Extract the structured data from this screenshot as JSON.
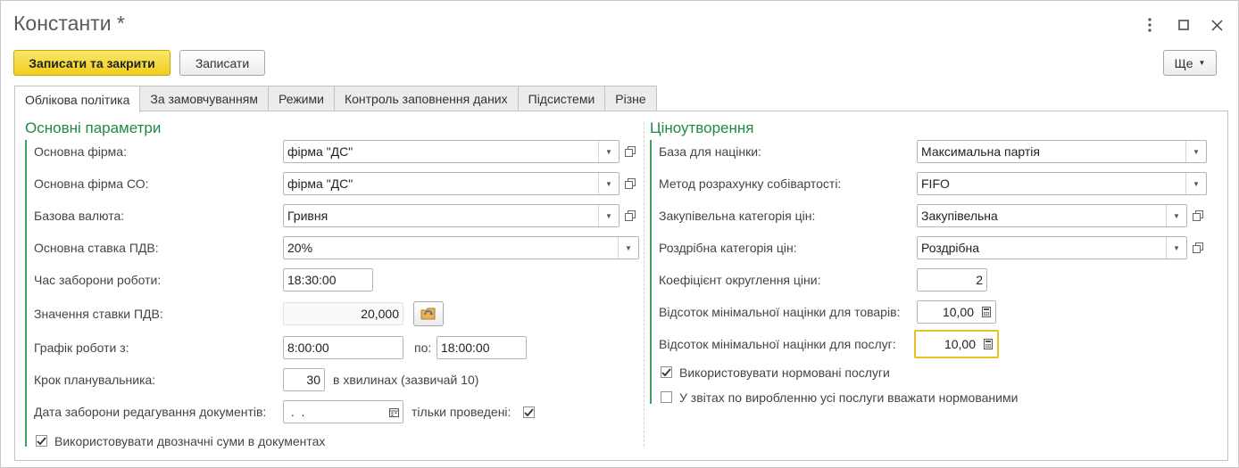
{
  "window": {
    "title": "Константи *"
  },
  "toolbar": {
    "save_close_label": "Записати та закрити",
    "save_label": "Записати",
    "more_label": "Ще"
  },
  "tabs": [
    {
      "label": "Облікова політика"
    },
    {
      "label": "За замовчуванням"
    },
    {
      "label": "Режими"
    },
    {
      "label": "Контроль заповнення даних"
    },
    {
      "label": "Підсистеми"
    },
    {
      "label": "Різне"
    }
  ],
  "left": {
    "section_title": "Основні параметри",
    "main_firm": {
      "label": "Основна фірма:",
      "value": "фірма \"ДС\""
    },
    "main_firm_co": {
      "label": "Основна фірма СО:",
      "value": "фірма \"ДС\""
    },
    "base_currency": {
      "label": "Базова валюта:",
      "value": "Гривня"
    },
    "vat_rate": {
      "label": "Основна ставка ПДВ:",
      "value": "20%"
    },
    "ban_time": {
      "label": "Час заборони роботи:",
      "value": "18:30:00"
    },
    "vat_value": {
      "label": "Значення ставки ПДВ:",
      "value": "20,000"
    },
    "schedule": {
      "label": "Графік роботи з:",
      "from": "8:00:00",
      "to_label": "по:",
      "to": "18:00:00"
    },
    "planner_step": {
      "label": "Крок планувальника:",
      "value": "30",
      "hint": "в хвилинах (зазвичай 10)"
    },
    "edit_ban_date": {
      "label": "Дата заборони редагування документів:",
      "value": " .  .",
      "posted_label": "тільки проведені:"
    },
    "two_digit_sums": {
      "label": "Використовувати двозначні суми в документах"
    }
  },
  "right": {
    "section_title": "Ціноутворення",
    "markup_base": {
      "label": "База для націнки:",
      "value": "Максимальна партія"
    },
    "cost_method": {
      "label": "Метод розрахунку собівартості:",
      "value": "FIFO"
    },
    "purchase_price_cat": {
      "label": "Закупівельна категорія цін:",
      "value": "Закупівельна"
    },
    "retail_price_cat": {
      "label": "Роздрібна категорія цін:",
      "value": "Роздрібна"
    },
    "rounding": {
      "label": "Коефіцієнт округлення ціни:",
      "value": "2"
    },
    "min_markup_goods": {
      "label": "Відсоток мінімальної націнки для товарів:",
      "value": "10,00"
    },
    "min_markup_services": {
      "label": "Відсоток мінімальної націнки для послуг:",
      "value": "10,00"
    },
    "normalized_services": {
      "label": "Використовувати нормовані послуги"
    },
    "all_services_normalized": {
      "label": "У звітах по виробленню усі послуги вважати нормованими"
    }
  }
}
